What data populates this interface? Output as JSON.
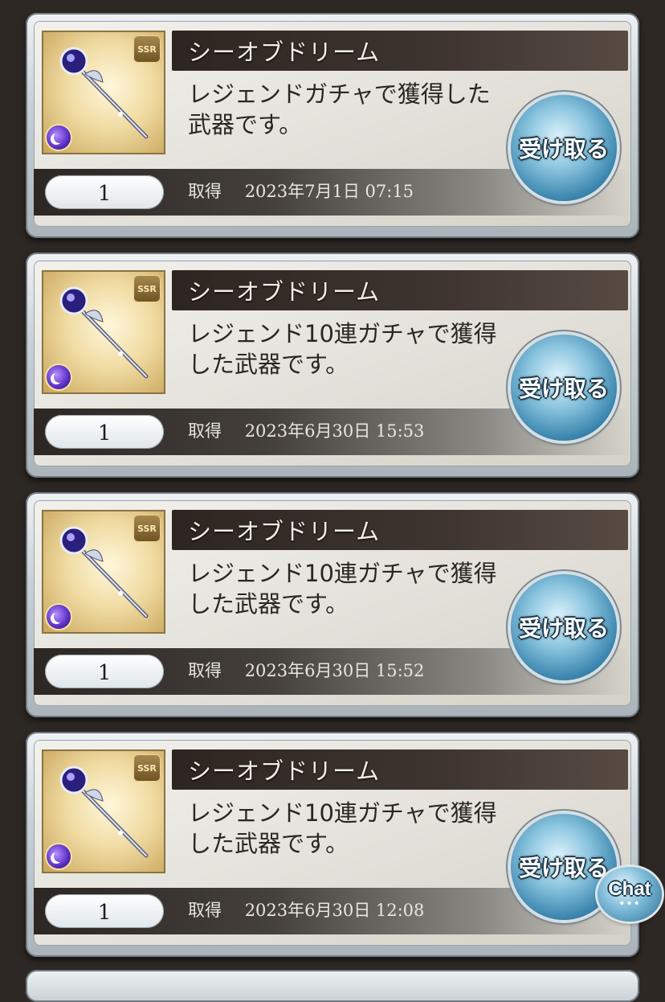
{
  "items": [
    {
      "name": "シーオブドリーム",
      "description": "レジェンドガチャで獲得した武器です。",
      "quantity": "1",
      "acquired_label": "取得",
      "acquired_date": "2023年7月1日 07:15",
      "button_label": "受け取る",
      "rarity": "SSR"
    },
    {
      "name": "シーオブドリーム",
      "description": "レジェンド10連ガチャで獲得した武器です。",
      "quantity": "1",
      "acquired_label": "取得",
      "acquired_date": "2023年6月30日 15:53",
      "button_label": "受け取る",
      "rarity": "SSR"
    },
    {
      "name": "シーオブドリーム",
      "description": "レジェンド10連ガチャで獲得した武器です。",
      "quantity": "1",
      "acquired_label": "取得",
      "acquired_date": "2023年6月30日 15:52",
      "button_label": "受け取る",
      "rarity": "SSR"
    },
    {
      "name": "シーオブドリーム",
      "description": "レジェンド10連ガチャで獲得した武器です。",
      "quantity": "1",
      "acquired_label": "取得",
      "acquired_date": "2023年6月30日 12:08",
      "button_label": "受け取る",
      "rarity": "SSR"
    }
  ],
  "chat": {
    "label": "Chat",
    "dots": "•••"
  },
  "icons": {
    "weapon": "staff-weapon-icon",
    "element": "dark-element-icon",
    "rarity": "ssr-badge"
  },
  "colors": {
    "background": "#2d2823",
    "title_bar": "#2e2521",
    "button": "#3d88b1",
    "thumbnail": "#f0dca3"
  }
}
